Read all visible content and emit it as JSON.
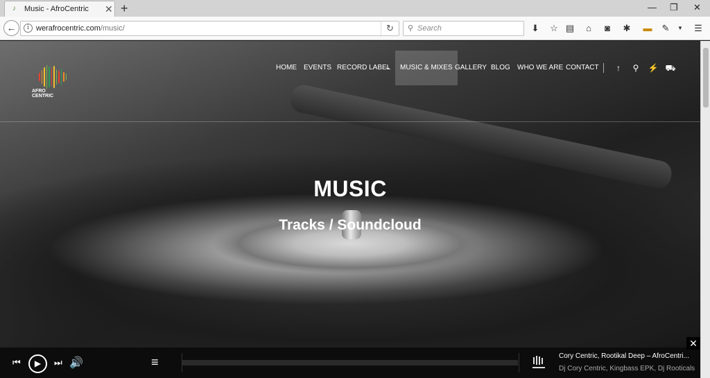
{
  "browser": {
    "tab_title": "Music - AfroCentric",
    "url_domain": "werafrocentric.com",
    "url_path": "/music/",
    "search_placeholder": "Search"
  },
  "site": {
    "logo_line1": "AFRO",
    "logo_line2": "CENTRIC",
    "logo_colors": [
      "#e8412c",
      "#f28c28",
      "#f2c12e",
      "#7ab648",
      "#2f9e5a",
      "#e8412c",
      "#f2c12e",
      "#7ab648",
      "#e8412c",
      "#2f9e5a",
      "#f28c28",
      "#7ab648"
    ],
    "nav": {
      "home": "HOME",
      "events": "EVENTS",
      "record_label": "RECORD LABEL",
      "music_mixes": "MUSIC & MIXES",
      "gallery": "GALLERY",
      "blog": "BLOG",
      "who_we_are": "WHO WE ARE",
      "contact": "CONTACT"
    }
  },
  "hero": {
    "title": "MUSIC",
    "subtitle": "Tracks / Soundcloud"
  },
  "player": {
    "track_title": "Cory Centric, Rootikal Deep – AfroCentri...",
    "track_artists": "Dj Cory Centric, Kingbass EPK, Dj Rooticals"
  }
}
